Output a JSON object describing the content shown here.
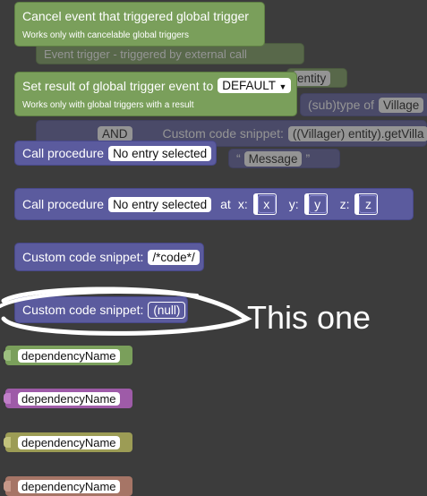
{
  "blocks": {
    "cancel_event": {
      "title": "Cancel event that triggered global trigger",
      "subtitle": "Works only with cancelable global triggers"
    },
    "set_result": {
      "title": "Set result of global trigger event to",
      "dropdown": "DEFAULT",
      "subtitle": "Works only with global triggers with a result"
    },
    "background": {
      "event_trigger": "Event trigger - triggered by external call",
      "entity_field": "entity",
      "subtype_label": "(sub)type of",
      "subtype_field": "Village",
      "and_label": "AND",
      "snippet_label": "Custom code snippet:",
      "snippet_value": "((Villager) entity).getVilla",
      "message_label": "Message"
    },
    "call_procedure": {
      "label": "Call procedure",
      "field": "No entry selected"
    },
    "call_procedure_at": {
      "label": "Call procedure",
      "field": "No entry selected",
      "at_label": "at",
      "x_label": "x:",
      "x_value": "x",
      "y_label": "y:",
      "y_value": "y",
      "z_label": "z:",
      "z_value": "z"
    },
    "snippet_code": {
      "label": "Custom code snippet:",
      "value": "/*code*/"
    },
    "snippet_null": {
      "label": "Custom code snippet:",
      "value": "(null)"
    },
    "dependencies": [
      {
        "label": "dependencyName",
        "color": "#7a9f5b"
      },
      {
        "label": "dependencyName",
        "color": "#9e5ba8"
      },
      {
        "label": "dependencyName",
        "color": "#9c9c55"
      },
      {
        "label": "dependencyName",
        "color": "#a67566"
      }
    ]
  },
  "annotation": {
    "text": "This one",
    "color": "#ffffff"
  }
}
